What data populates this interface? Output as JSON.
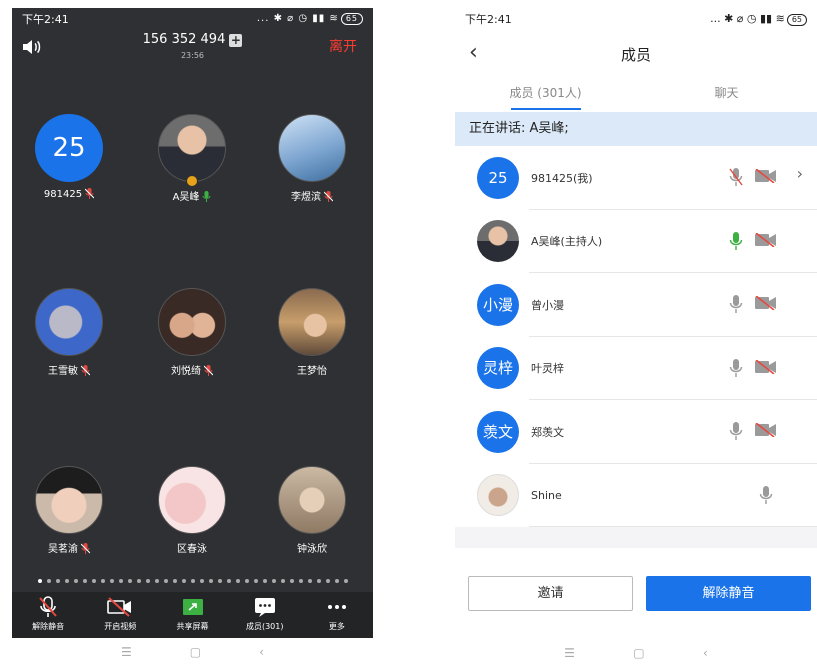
{
  "left": {
    "status": {
      "time": "下午2:41",
      "icons": "... ✱ ⌀ ◷ ▮▮ ≋",
      "battery": "65"
    },
    "header": {
      "meeting_id": "156 352 494",
      "duration": "23:56",
      "leave_label": "离开"
    },
    "participants": [
      {
        "name": "981425",
        "avatar_text": "25",
        "mic": "muted"
      },
      {
        "name": "A吴峰",
        "avatar_text": "",
        "mic": "on",
        "host": true
      },
      {
        "name": "李煜滨",
        "avatar_text": "",
        "mic": "muted"
      },
      {
        "name": "王雪敏",
        "avatar_text": "",
        "mic": "muted"
      },
      {
        "name": "刘悦绮",
        "avatar_text": "",
        "mic": "muted"
      },
      {
        "name": "王梦怡",
        "avatar_text": "",
        "mic": "none"
      },
      {
        "name": "吴茗渝",
        "avatar_text": "",
        "mic": "muted"
      },
      {
        "name": "区春泳",
        "avatar_text": "",
        "mic": "none"
      },
      {
        "name": "钟泳欣",
        "avatar_text": "",
        "mic": "none"
      }
    ],
    "toolbar": [
      {
        "label": "解除静音",
        "icon": "mic-muted-icon"
      },
      {
        "label": "开启视频",
        "icon": "camera-off-icon"
      },
      {
        "label": "共享屏幕",
        "icon": "share-screen-icon"
      },
      {
        "label": "成员(301)",
        "icon": "members-icon"
      },
      {
        "label": "更多",
        "icon": "more-icon"
      }
    ]
  },
  "right": {
    "status": {
      "time": "下午2:41",
      "icons": "... ✱ ⌀ ◷ ▮▮ ≋",
      "battery": "65"
    },
    "title": "成员",
    "tabs": [
      {
        "label": "成员 (301人)",
        "active": true
      },
      {
        "label": "聊天",
        "active": false
      }
    ],
    "speaking": "正在讲话: A吴峰;",
    "members": [
      {
        "name": "981425(我)",
        "avatar_text": "25",
        "mic": "muted-gray",
        "cam": "off",
        "arrow": true
      },
      {
        "name": "A吴峰(主持人)",
        "avatar_text": "",
        "mic": "active-green",
        "cam": "off"
      },
      {
        "name": "曾小漫",
        "avatar_text": "小漫",
        "mic": "gray",
        "cam": "off"
      },
      {
        "name": "叶灵梓",
        "avatar_text": "灵梓",
        "mic": "gray",
        "cam": "off"
      },
      {
        "name": "郑羡文",
        "avatar_text": "羡文",
        "mic": "gray",
        "cam": "off"
      },
      {
        "name": "Shine",
        "avatar_text": "",
        "mic": "gray",
        "cam": "none"
      }
    ],
    "invite_label": "邀请",
    "unmute_label": "解除静音"
  },
  "colors": {
    "accent": "#1a73e8",
    "leave": "#ff3b30",
    "muted_red": "#e5483f",
    "active_green": "#3cb043"
  }
}
